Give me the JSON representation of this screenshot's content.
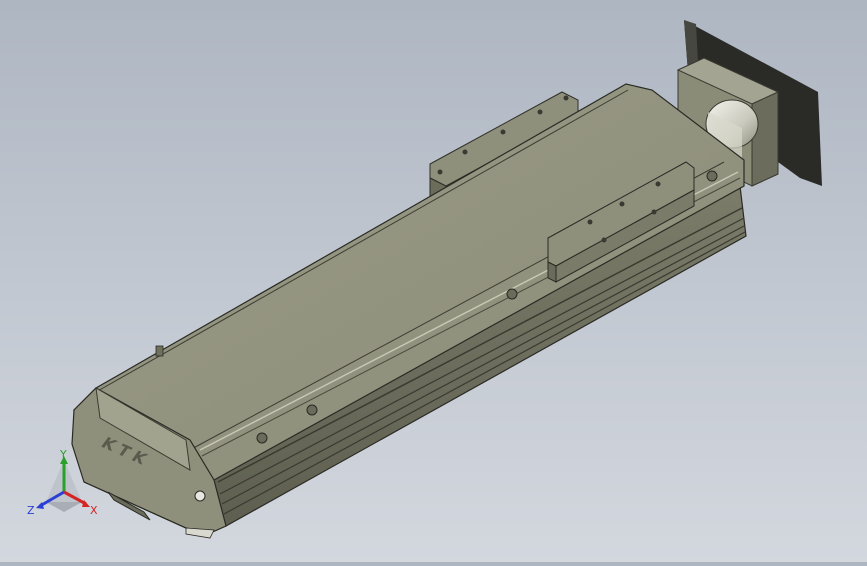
{
  "viewport": {
    "background_top": "#aeb6c2",
    "background_bottom": "#d3d7de"
  },
  "model": {
    "name": "linear-actuator-module",
    "body_color": "#8e8f7c",
    "logo_text": "KTK"
  },
  "triad": {
    "x_label": "X",
    "y_label": "Y",
    "z_label": "Z",
    "x_color": "#d42424",
    "y_color": "#2aa02a",
    "z_color": "#2a3fd4"
  }
}
